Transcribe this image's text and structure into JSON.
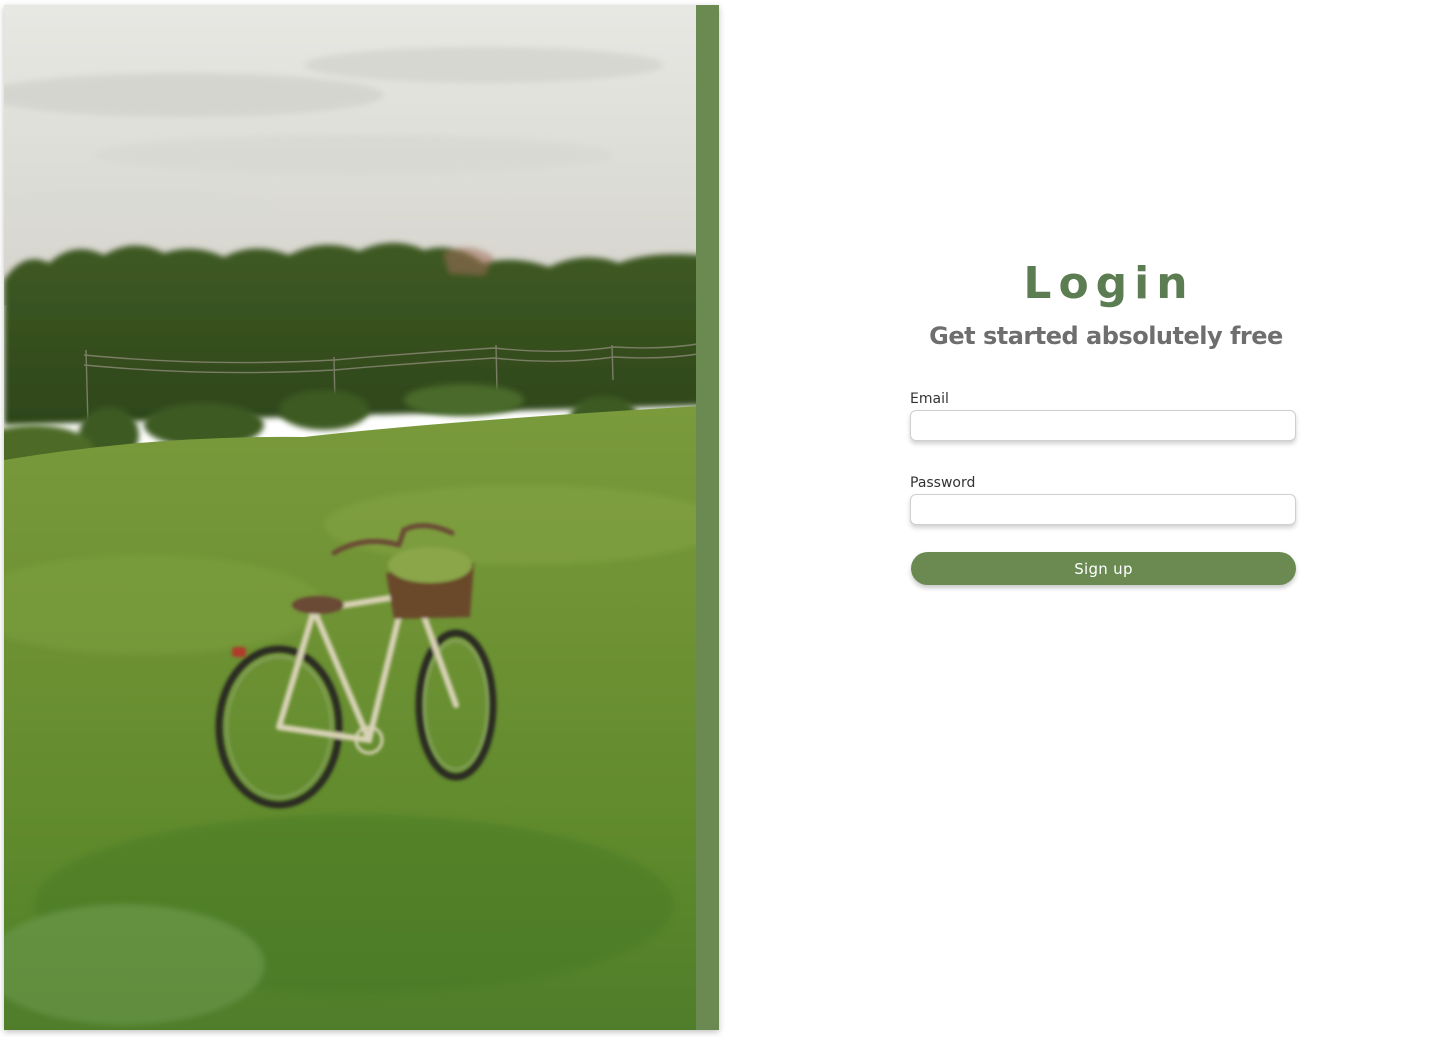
{
  "login_form": {
    "title": "Login",
    "subtitle": "Get started absolutely free",
    "email_label": "Email",
    "email_value": "",
    "password_label": "Password",
    "password_value": "",
    "submit_label": "Sign up"
  },
  "hero_image": {
    "description_icon": "bicycle-in-meadow-photo"
  },
  "colors": {
    "accent": "#6a8a52",
    "title": "#5c7c52",
    "subtitle": "#6e6e6e",
    "label": "#333333",
    "background": "#ffffff"
  }
}
